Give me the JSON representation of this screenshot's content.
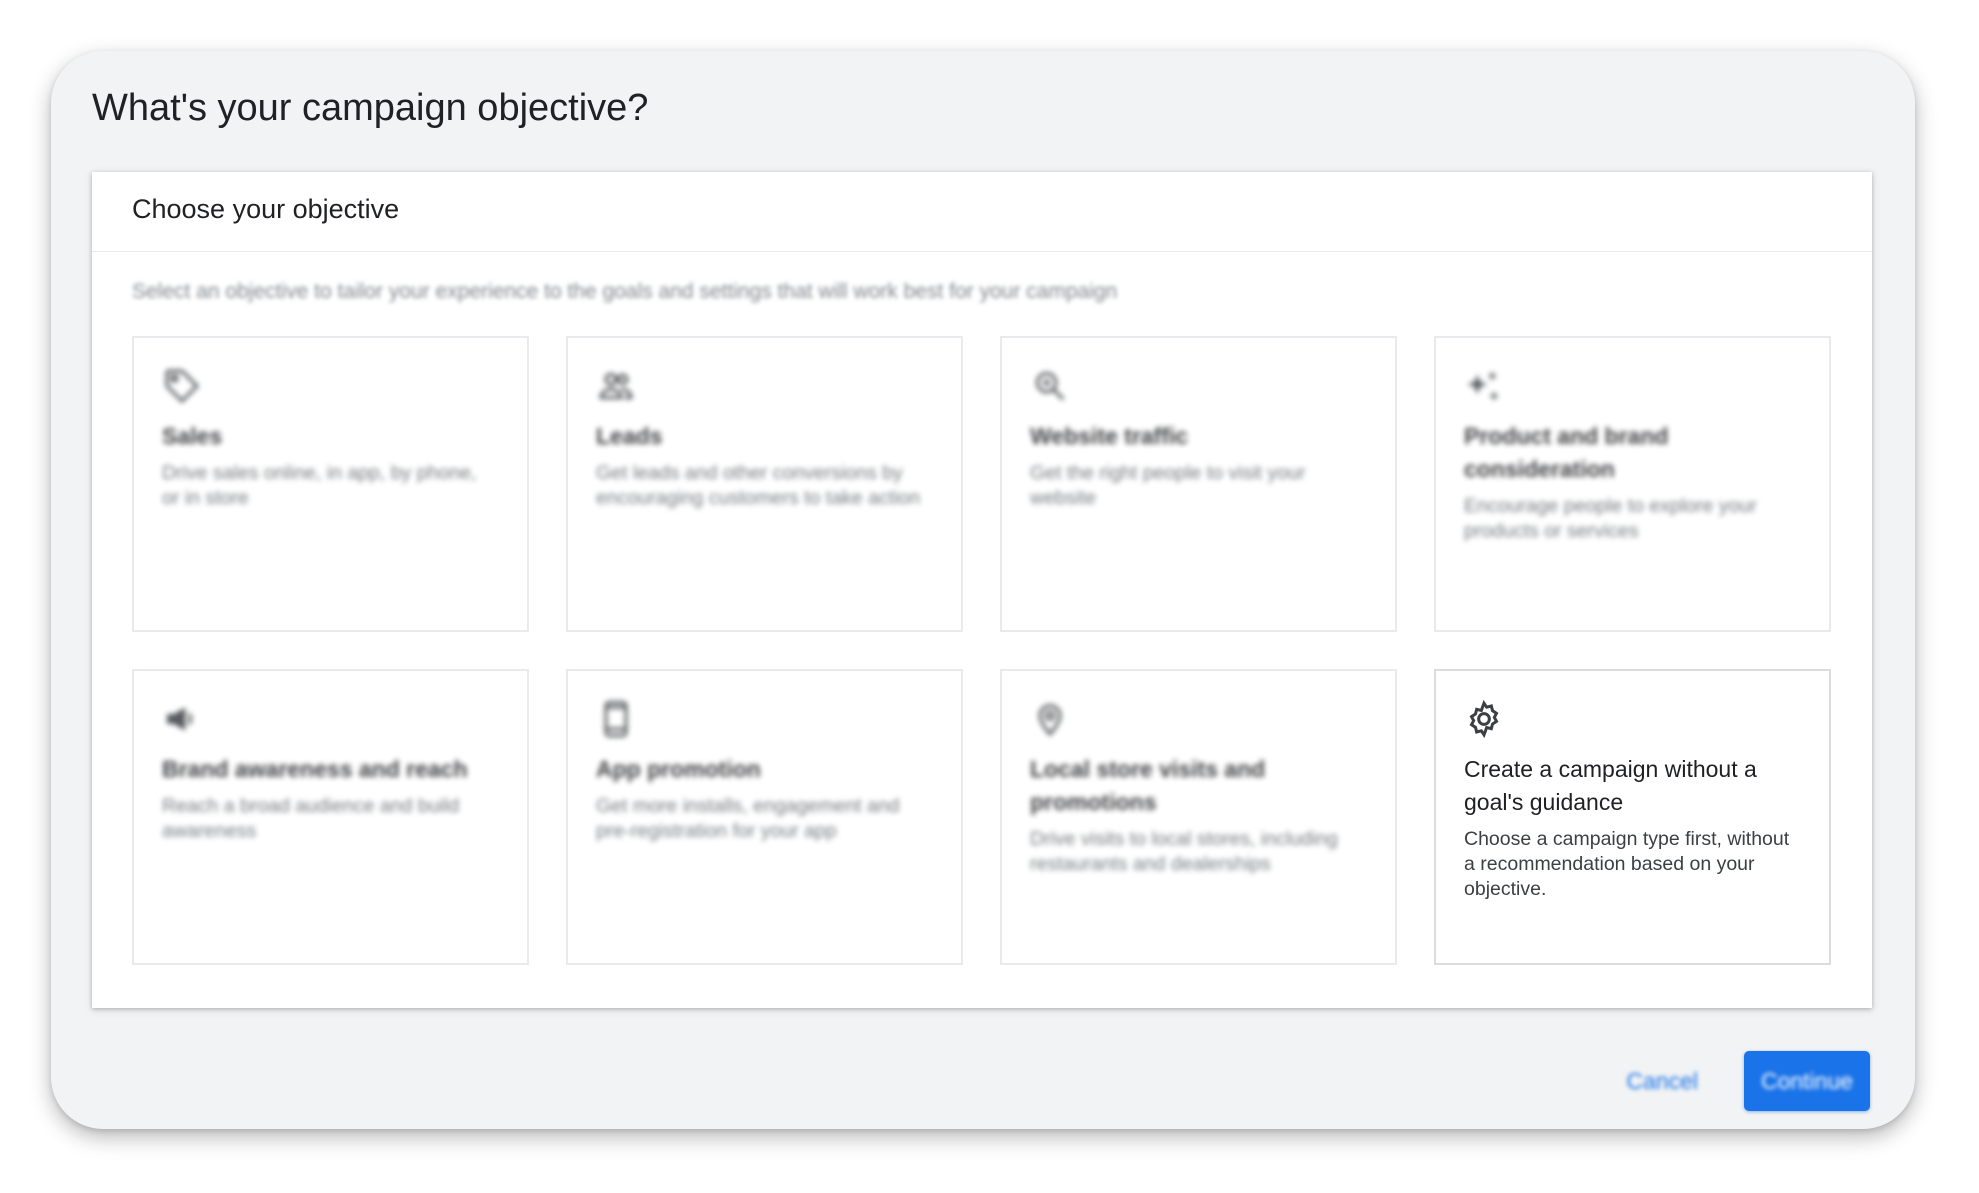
{
  "dialog": {
    "title": "What's your campaign objective?"
  },
  "panel": {
    "title": "Choose your objective",
    "subtitle": "Select an objective to tailor your experience to the goals and settings that will work best for your campaign"
  },
  "objectives": [
    {
      "icon": "tag-icon",
      "title": "Sales",
      "description": "Drive sales online, in app, by phone, or in store"
    },
    {
      "icon": "people-icon",
      "title": "Leads",
      "description": "Get leads and other conversions by encouraging customers to take action"
    },
    {
      "icon": "cursor-search-icon",
      "title": "Website traffic",
      "description": "Get the right people to visit your website"
    },
    {
      "icon": "sparkle-icon",
      "title": "Product and brand consideration",
      "description": "Encourage people to explore your products or services"
    },
    {
      "icon": "megaphone-icon",
      "title": "Brand awareness and reach",
      "description": "Reach a broad audience and build awareness"
    },
    {
      "icon": "phone-icon",
      "title": "App promotion",
      "description": "Get more installs, engagement and pre-registration for your app"
    },
    {
      "icon": "location-pin-icon",
      "title": "Local store visits and promotions",
      "description": "Drive visits to local stores, including restaurants and dealerships"
    },
    {
      "icon": "gear-icon",
      "title": "Create a campaign without a goal's guidance",
      "description": "Choose a campaign type first, without a recommendation based on your objective."
    }
  ],
  "actions": {
    "cancel_label": "Cancel",
    "continue_label": "Continue"
  },
  "colors": {
    "accent": "#1a73e8",
    "frame_background": "#f1f3f4",
    "panel_background": "#ffffff"
  }
}
